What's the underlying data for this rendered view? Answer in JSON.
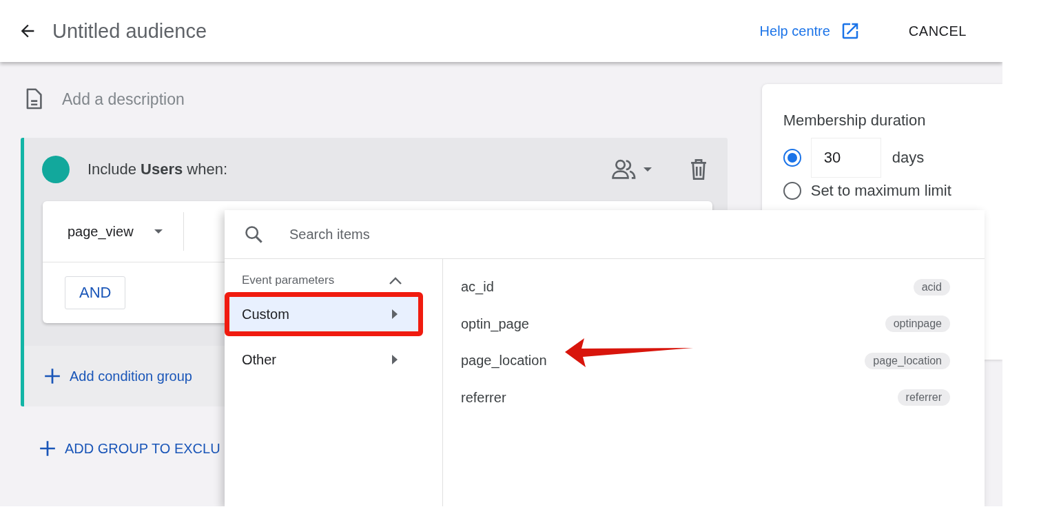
{
  "header": {
    "title": "Untitled audience",
    "help_link": "Help centre",
    "cancel": "CANCEL"
  },
  "description": {
    "placeholder": "Add a description"
  },
  "group": {
    "heading": "Include **Users** when:",
    "condition": {
      "event": "page_view",
      "and_button": "AND"
    },
    "add_condition_group": "Add condition group"
  },
  "add_exclude": "ADD GROUP TO EXCLU",
  "membership": {
    "title": "Membership duration",
    "options": [
      {
        "kind": "days",
        "selected": true,
        "value": "30",
        "unit": "days"
      },
      {
        "kind": "max",
        "selected": false,
        "label": "Set to maximum limit"
      }
    ]
  },
  "dropdown": {
    "search_placeholder": "Search items",
    "section": {
      "label": "Event parameters",
      "expanded": true
    },
    "categories": [
      {
        "label": "Custom",
        "selected": true
      },
      {
        "label": "Other",
        "selected": false
      }
    ],
    "items": [
      {
        "name": "ac_id",
        "tag": "acid"
      },
      {
        "name": "optin_page",
        "tag": "optinpage"
      },
      {
        "name": "page_location",
        "tag": "page_location"
      },
      {
        "name": "referrer",
        "tag": "referrer"
      }
    ]
  }
}
